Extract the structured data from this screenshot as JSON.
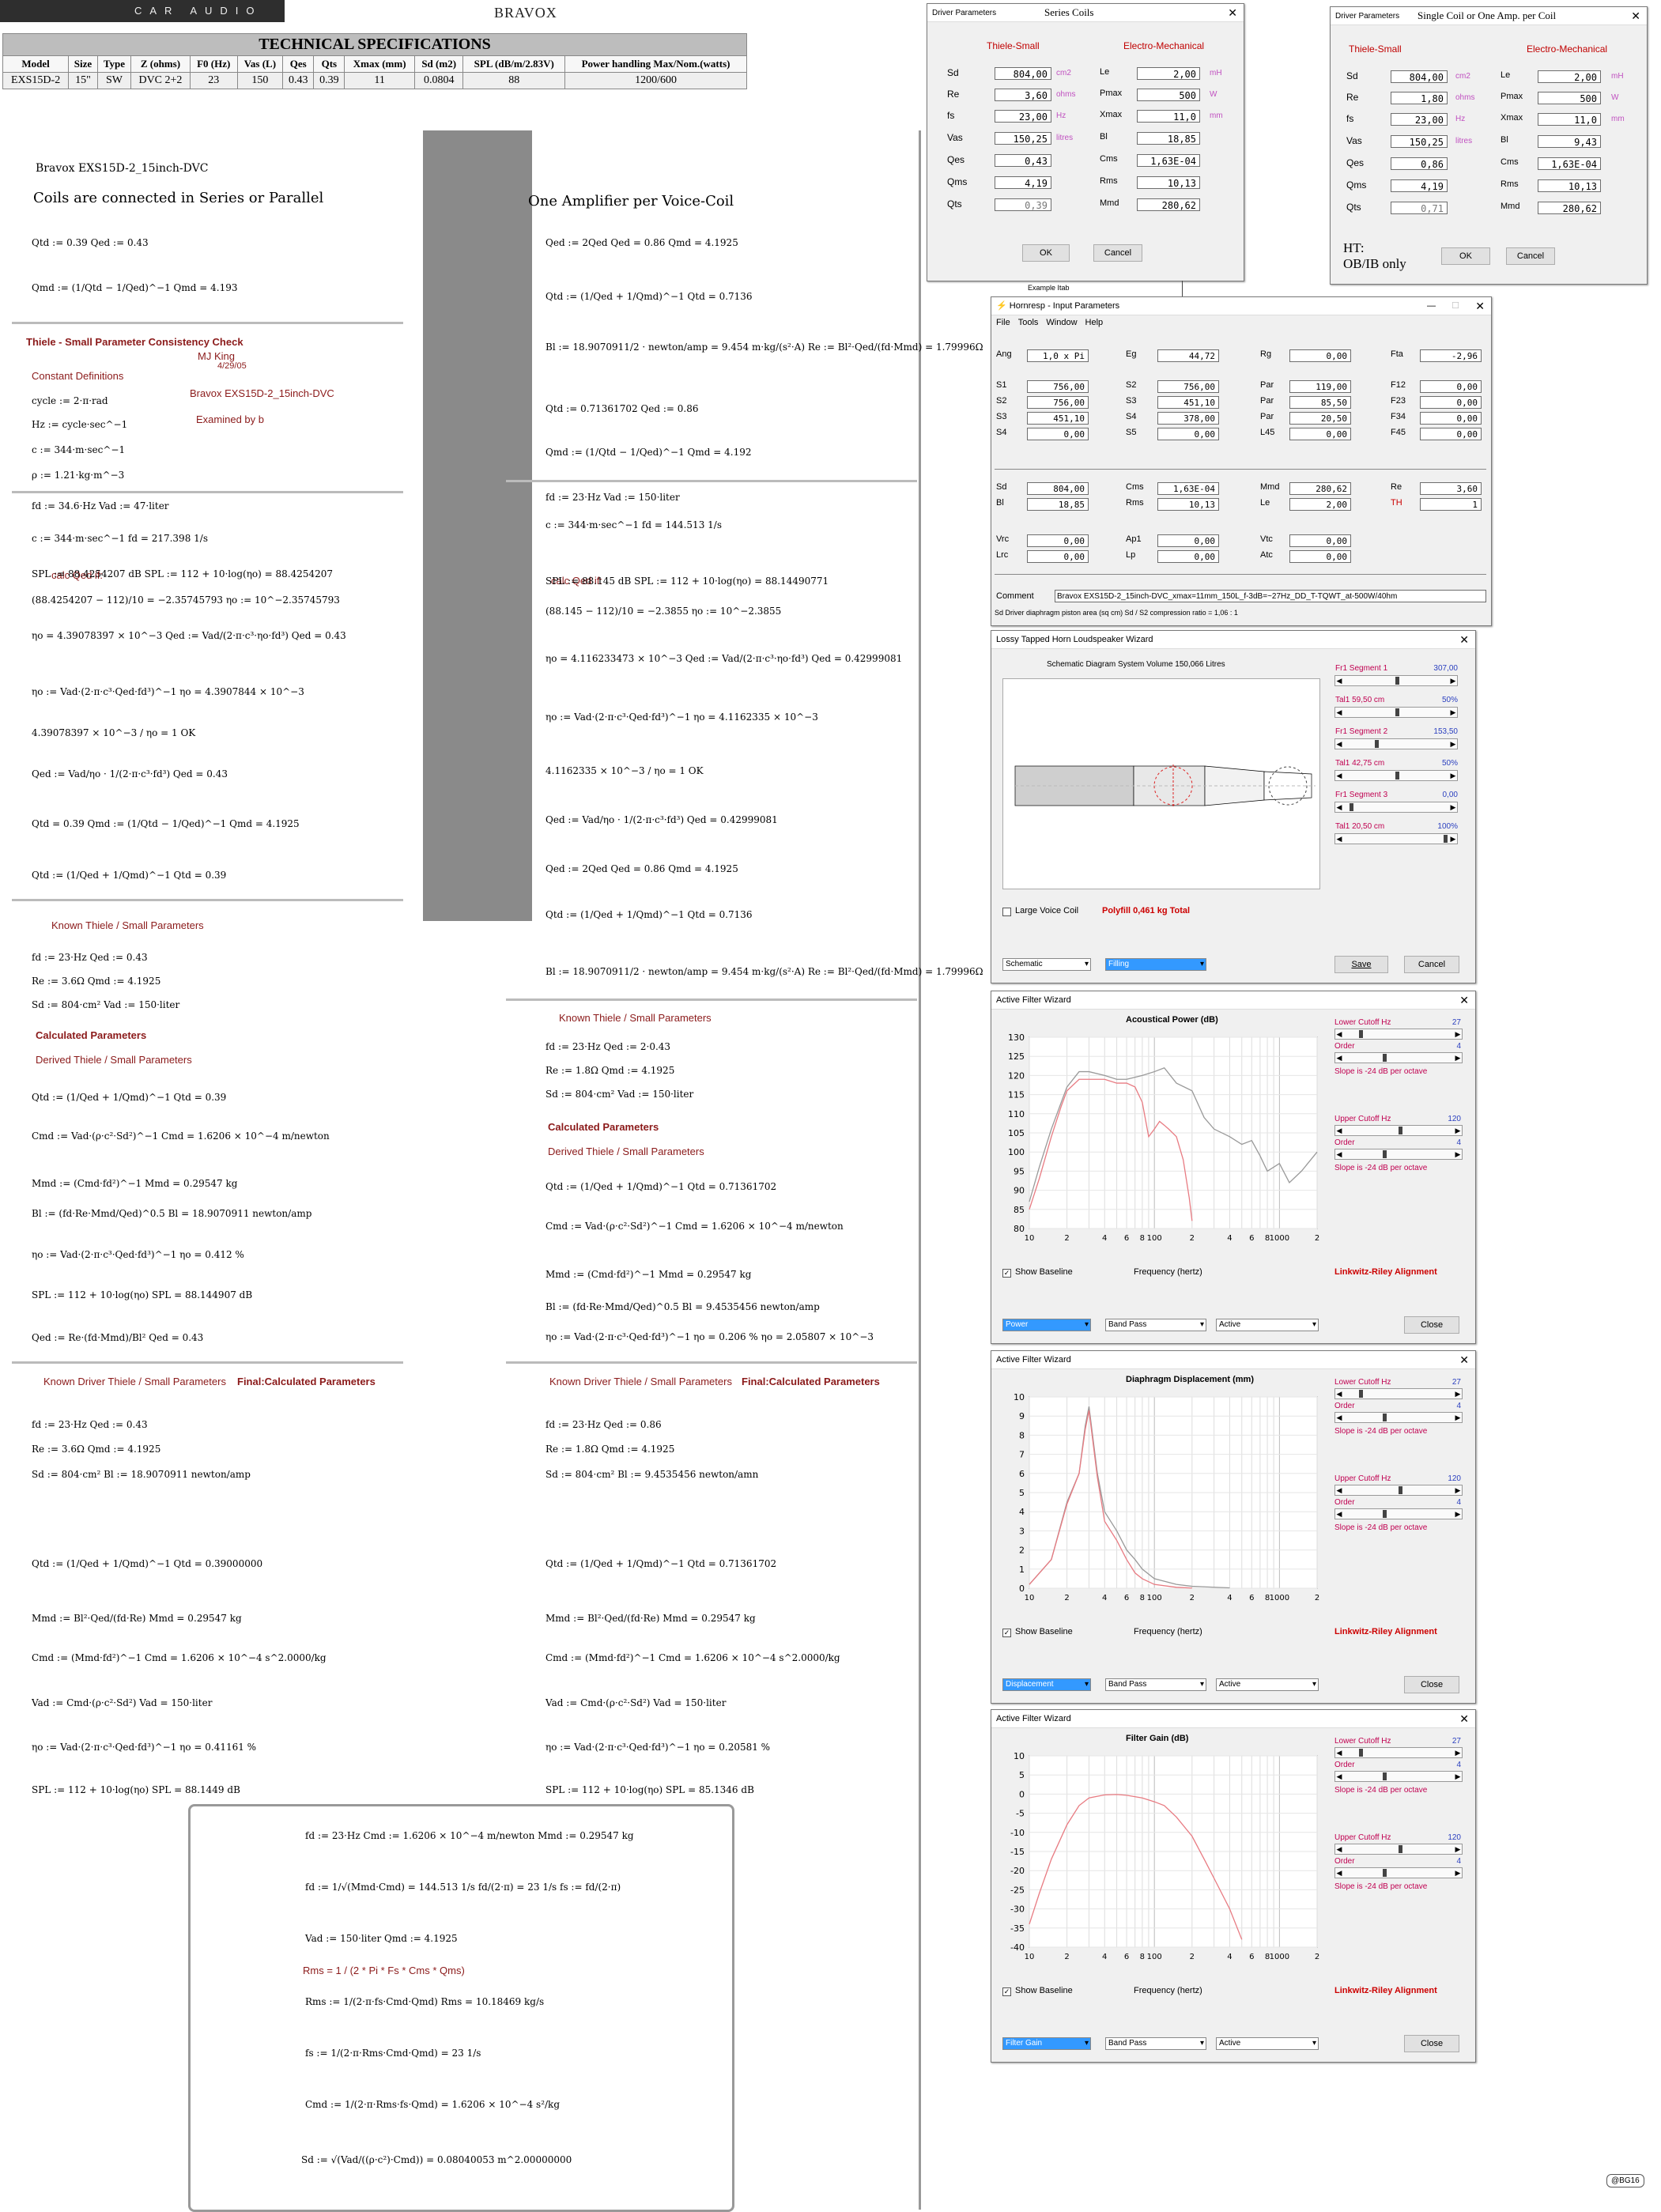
{
  "header": {
    "brand_left": "CAR AUDIO",
    "brand_right": "BRAVOX"
  },
  "spec_table": {
    "title": "TECHNICAL SPECIFICATIONS",
    "columns": [
      "Model",
      "Size",
      "Type",
      "Z (ohms)",
      "F0 (Hz)",
      "Vas (L)",
      "Qes",
      "Qts",
      "Xmax (mm)",
      "Sd (m2)",
      "SPL (dB/m/2.83V)",
      "Power handling Max/Nom.(watts)"
    ],
    "values": [
      "EXS15D-2",
      "15\"",
      "SW",
      "DVC 2+2",
      "23",
      "150",
      "0.43",
      "0.39",
      "11",
      "0.0804",
      "88",
      "1200/600"
    ]
  },
  "left": {
    "doc_title": "Bravox EXS15D-2_15inch-DVC",
    "heading": "Coils are connected in Series or Parallel",
    "consistency": "Thiele - Small Parameter Consistency Check",
    "author": "MJ King",
    "date": "4/29/05",
    "model_note": "Bravox EXS15D-2_15inch-DVC",
    "constants": "Constant Definitions",
    "examined": "Examined by b",
    "calc_qed": "calc Qed if:",
    "known": "Known Thiele / Small Parameters",
    "calculated": "Calculated Parameters",
    "derived": "Derived Thiele / Small Parameters",
    "final_known": "Known Driver Thiele / Small Parameters",
    "final_calc": "Final:Calculated Parameters",
    "eqs": [
      "Qtd := 0.39   Qed := 0.43",
      "Qmd := (1/Qtd − 1/Qed)^−1     Qmd = 4.193",
      "cycle := 2·π·rad",
      "Hz := cycle·sec^−1",
      "c := 344·m·sec^−1",
      "ρ := 1.21·kg·m^−3",
      "fd := 34.6·Hz        Vad := 47·liter",
      "c := 344·m·sec^−1        fd = 217.398 1/s",
      "SPL := 88.4254207 dB   SPL := 112 + 10·log(ηo) = 88.4254207",
      "(88.4254207 − 112)/10 = −2.35745793    ηo := 10^−2.35745793",
      "ηo = 4.39078397 × 10^−3    Qed := Vad/(2·π·c³·ηo·fd³)    Qed = 0.43",
      "ηo := Vad·(2·π·c³·Qed·fd³)^−1    ηo = 4.3907844 × 10^−3",
      "4.39078397 × 10^−3 / ηo = 1    OK",
      "Qed := Vad/ηo · 1/(2·π·c³·fd³)    Qed = 0.43",
      "Qtd = 0.39   Qmd := (1/Qtd − 1/Qed)^−1    Qmd = 4.1925",
      "Qtd := (1/Qed + 1/Qmd)^−1    Qtd = 0.39",
      "fd := 23·Hz        Qed := 0.43",
      "Re := 3.6Ω         Qmd := 4.1925",
      "Sd := 804·cm²      Vad := 150·liter",
      "Qtd := (1/Qed + 1/Qmd)^−1    Qtd = 0.39",
      "Cmd := Vad·(ρ·c²·Sd²)^−1    Cmd = 1.6206 × 10^−4 m/newton",
      "Mmd := (Cmd·fd²)^−1    Mmd = 0.29547 kg",
      "Bl := (fd·Re·Mmd/Qed)^0.5    Bl = 18.9070911 newton/amp",
      "ηo := Vad·(2·π·c³·Qed·fd³)^−1    ηo = 0.412 %",
      "SPL := 112 + 10·log(ηo)    SPL = 88.144907 dB",
      "Qed := Re·(fd·Mmd)/Bl²    Qed = 0.43",
      "fd := 23·Hz    Qed := 0.43",
      "Re := 3.6Ω    Qmd := 4.1925",
      "Sd := 804·cm²    Bl := 18.9070911 newton/amp",
      "Qtd := (1/Qed + 1/Qmd)^−1    Qtd = 0.39000000",
      "Mmd := Bl²·Qed/(fd·Re)    Mmd = 0.29547 kg",
      "Cmd := (Mmd·fd²)^−1    Cmd = 1.6206 × 10^−4 s^2.0000/kg",
      "Vad := Cmd·(ρ·c²·Sd²)    Vad = 150·liter",
      "ηo := Vad·(2·π·c³·Qed·fd³)^−1    ηo = 0.41161 %",
      "SPL := 112 + 10·log(ηo)    SPL = 88.1449 dB"
    ]
  },
  "mid": {
    "heading": "One Amplifier per Voice-Coil",
    "known": "Known Thiele / Small Parameters",
    "calculated": "Calculated Parameters",
    "derived": "Derived Thiele / Small Parameters",
    "final_known": "Known Driver Thiele / Small Parameters",
    "final_calc": "Final:Calculated Parameters",
    "calc_qed": "calc Qed if:",
    "eqs": [
      "Qed := 2Qed      Qed = 0.86      Qmd = 4.1925",
      "Qtd := (1/Qed + 1/Qmd)^−1     Qtd = 0.7136",
      "Bl := 18.9070911/2 · newton/amp = 9.454 m·kg/(s²·A)      Re := Bl²·Qed/(fd·Mmd) = 1.79996Ω",
      "Qtd := 0.71361702      Qed := 0.86",
      "Qmd := (1/Qtd − 1/Qed)^−1      Qmd = 4.192",
      "fd := 23·Hz      Vad := 150·liter",
      "c := 344·m·sec^−1      fd = 144.513 1/s",
      "SPL := 88.145      dB SPL := 112 + 10·log(ηo) = 88.14490771",
      "(88.145 − 112)/10 = −2.3855      ηo := 10^−2.3855",
      "ηo = 4.116233473 × 10^−3      Qed := Vad/(2·π·c³·ηo·fd³)      Qed = 0.42999081",
      "ηo := Vad·(2·π·c³·Qed·fd³)^−1      ηo = 4.1162335 × 10^−3",
      "4.1162335 × 10^−3 / ηo = 1      OK",
      "Qed := Vad/ηo · 1/(2·π·c³·fd³)      Qed = 0.42999081",
      "Qed := 2Qed      Qed = 0.86      Qmd = 4.1925",
      "Qtd := (1/Qed + 1/Qmd)^−1      Qtd = 0.7136",
      "Bl := 18.9070911/2 · newton/amp = 9.454 m·kg/(s²·A)      Re := Bl²·Qed/(fd·Mmd) = 1.79996Ω",
      "fd := 23·Hz      Qed := 2·0.43",
      "Re := 1.8Ω      Qmd := 4.1925",
      "Sd := 804·cm²      Vad := 150·liter",
      "Qtd := (1/Qed + 1/Qmd)^−1      Qtd = 0.71361702",
      "Cmd := Vad·(ρ·c²·Sd²)^−1      Cmd = 1.6206 × 10^−4 m/newton",
      "Mmd := (Cmd·fd²)^−1      Mmd = 0.29547 kg",
      "Bl := (fd·Re·Mmd/Qed)^0.5      Bl = 9.4535456 newton/amp",
      "ηo := Vad·(2·π·c³·Qed·fd³)^−1      ηo = 0.206 %      ηo = 2.05807 × 10^−3",
      "fd := 23·Hz      Qed := 0.86",
      "Re := 1.8Ω      Qmd := 4.1925",
      "Sd := 804·cm²      Bl := 9.4535456 newton/amn",
      "Qtd := (1/Qed + 1/Qmd)^−1      Qtd = 0.71361702",
      "Mmd := Bl²·Qed/(fd·Re)      Mmd = 0.29547 kg",
      "Cmd := (Mmd·fd²)^−1      Cmd = 1.6206 × 10^−4 s^2.0000/kg",
      "Vad := Cmd·(ρ·c²·Sd²)      Vad = 150·liter",
      "ηo := Vad·(2·π·c³·Qed·fd³)^−1      ηo = 0.20581 %",
      "SPL := 112 + 10·log(ηo)      SPL = 85.1346 dB"
    ]
  },
  "bottom_box": {
    "rms_formula": "Rms = 1 / (2 * Pi * Fs * Cms * Qms)",
    "eqs": [
      "fd := 23·Hz      Cmd := 1.6206 × 10^−4 m/newton      Mmd := 0.29547 kg",
      "fd := 1/√(Mmd·Cmd) = 144.513 1/s      fd/(2·π) = 23 1/s      fs := fd/(2·π)",
      "Vad := 150·liter      Qmd := 4.1925",
      "Rms := 1/(2·π·fs·Cmd·Qmd)      Rms = 10.18469 kg/s",
      "fs := 1/(2·π·Rms·Cmd·Qmd) = 23 1/s",
      "Cmd := 1/(2·π·Rms·fs·Qmd) = 1.6206 × 10^−4 s²/kg",
      "Sd := √(Vad/((ρ·c²)·Cmd)) = 0.08040053 m^2.00000000"
    ]
  },
  "win_series": {
    "title_small": "Driver Parameters",
    "title": "Series Coils",
    "ts_label": "Thiele-Small",
    "em_label": "Electro-Mechanical",
    "left_rows": [
      [
        "Sd",
        "804,00",
        "cm2"
      ],
      [
        "Re",
        "3,60",
        "ohms"
      ],
      [
        "fs",
        "23,00",
        "Hz"
      ],
      [
        "Vas",
        "150,25",
        "litres"
      ],
      [
        "Qes",
        "0,43",
        ""
      ],
      [
        "Qms",
        "4,19",
        ""
      ],
      [
        "Qts",
        "0,39",
        ""
      ]
    ],
    "right_rows": [
      [
        "Le",
        "2,00",
        "mH"
      ],
      [
        "Pmax",
        "500",
        "W"
      ],
      [
        "Xmax",
        "11,0",
        "mm"
      ],
      [
        "Bl",
        "18,85",
        ""
      ],
      [
        "Cms",
        "1,63E-04",
        ""
      ],
      [
        "Rms",
        "10,13",
        ""
      ],
      [
        "Mmd",
        "280,62",
        ""
      ]
    ],
    "ok": "OK",
    "cancel": "Cancel"
  },
  "win_single": {
    "title_small": "Driver Parameters",
    "title": "Single Coil or One Amp. per Coil",
    "ts_label": "Thiele-Small",
    "em_label": "Electro-Mechanical",
    "left_rows": [
      [
        "Sd",
        "804,00",
        "cm2"
      ],
      [
        "Re",
        "1,80",
        "ohms"
      ],
      [
        "fs",
        "23,00",
        "Hz"
      ],
      [
        "Vas",
        "150,25",
        "litres"
      ],
      [
        "Qes",
        "0,86",
        ""
      ],
      [
        "Qms",
        "4,19",
        ""
      ],
      [
        "Qts",
        "0,71",
        ""
      ]
    ],
    "right_rows": [
      [
        "Le",
        "2,00",
        "mH"
      ],
      [
        "Pmax",
        "500",
        "W"
      ],
      [
        "Xmax",
        "11,0",
        "mm"
      ],
      [
        "Bl",
        "9,43",
        ""
      ],
      [
        "Cms",
        "1,63E-04",
        ""
      ],
      [
        "Rms",
        "10,13",
        ""
      ],
      [
        "Mmd",
        "280,62",
        ""
      ]
    ],
    "note": "HT:\nOB/IB only",
    "ok": "OK",
    "cancel": "Cancel"
  },
  "example_tab": "Example Itab",
  "hornresp": {
    "title": "Hornresp - Input Parameters",
    "menu": [
      "File",
      "Tools",
      "Window",
      "Help"
    ],
    "rows": [
      [
        [
          "Ang",
          "1,0 x Pi"
        ],
        [
          "Eg",
          "44,72"
        ],
        [
          "Rg",
          "0,00"
        ],
        [
          "Fta",
          "-2,96"
        ]
      ],
      [
        [
          "S1",
          "756,00"
        ],
        [
          "S2",
          "756,00"
        ],
        [
          "Par",
          "119,00"
        ],
        [
          "F12",
          "0,00"
        ]
      ],
      [
        [
          "S2",
          "756,00"
        ],
        [
          "S3",
          "451,10"
        ],
        [
          "Par",
          "85,50"
        ],
        [
          "F23",
          "0,00"
        ]
      ],
      [
        [
          "S3",
          "451,10"
        ],
        [
          "S4",
          "378,00"
        ],
        [
          "Par",
          "20,50"
        ],
        [
          "F34",
          "0,00"
        ]
      ],
      [
        [
          "S4",
          "0,00"
        ],
        [
          "S5",
          "0,00"
        ],
        [
          "L45",
          "0,00"
        ],
        [
          "F45",
          "0,00"
        ]
      ],
      [
        [
          "Sd",
          "804,00"
        ],
        [
          "Cms",
          "1,63E-04"
        ],
        [
          "Mmd",
          "280,62"
        ],
        [
          "Re",
          "3,60"
        ]
      ],
      [
        [
          "Bl",
          "18,85"
        ],
        [
          "Rms",
          "10,13"
        ],
        [
          "Le",
          "2,00"
        ],
        [
          "TH",
          "1"
        ]
      ],
      [
        [
          "Vrc",
          "0,00"
        ],
        [
          "Ap1",
          "0,00"
        ],
        [
          "Vtc",
          "0,00"
        ],
        [
          "",
          ""
        ]
      ],
      [
        [
          "Lrc",
          "0,00"
        ],
        [
          "Lp",
          "0,00"
        ],
        [
          "Atc",
          "0,00"
        ],
        [
          "",
          ""
        ]
      ]
    ],
    "comment_label": "Comment",
    "comment": "Bravox EXS15D-2_15inch-DVC_xmax=11mm_150L_f-3dB=~27Hz_DD_T-TQWT_at-500W/40hm",
    "status": "Sd  Driver diaphragm piston area  (sq cm)  Sd / S2 compression ratio = 1,06 : 1"
  },
  "lossy": {
    "title": "Lossy Tapped Horn Loudspeaker Wizard",
    "diagram_title": "Schematic Diagram   System Volume 150,066 Litres",
    "sliders": [
      [
        "Fr1  Segment 1",
        "307,00"
      ],
      [
        "Tal1  59,50 cm",
        "50%"
      ],
      [
        "Fr1  Segment 2",
        "153,50"
      ],
      [
        "Tal1  42,75 cm",
        "50%"
      ],
      [
        "Fr1  Segment 3",
        "0,00"
      ],
      [
        "Tal1  20,50 cm",
        "100%"
      ]
    ],
    "large_vc": "Large Voice Coil",
    "polyfill": "Polyfill   0,461  kg   Total",
    "dd1": "Schematic",
    "dd2": "Filling",
    "save": "Save",
    "cancel": "Cancel"
  },
  "filter_common": {
    "title": "Active Filter Wizard",
    "lower": "Lower Cutoff  Hz",
    "lower_val": "27",
    "order": "Order",
    "order_val": "4",
    "slope": "Slope is -24 dB per octave",
    "upper": "Upper Cutoff  Hz",
    "upper_val": "120",
    "show_baseline": "Show Baseline",
    "freq_label": "Frequency (hertz)",
    "alignment": "Linkwitz-Riley Alignment",
    "band_pass": "Band Pass",
    "active": "Active",
    "close": "Close",
    "x_ticks": [
      "10",
      "2",
      "4",
      "6",
      "8",
      "100",
      "2",
      "4",
      "6",
      "8",
      "1000",
      "2"
    ]
  },
  "chart_data": [
    {
      "type": "line",
      "title": "Acoustical Power (dB)",
      "xlabel": "Frequency (hertz)",
      "ylabel": "",
      "log_x": true,
      "ylim": [
        80,
        130
      ],
      "yticks": [
        130,
        125,
        120,
        115,
        110,
        105,
        100,
        95,
        90,
        85,
        80
      ],
      "series": [
        {
          "color": "#999999",
          "x": [
            10,
            12,
            15,
            18,
            20,
            25,
            30,
            40,
            50,
            60,
            80,
            100,
            120,
            150,
            200,
            250,
            300,
            400,
            500,
            600,
            700,
            800,
            1000,
            1200,
            1500,
            2000
          ],
          "values": [
            87,
            96,
            106,
            113,
            117,
            121,
            121,
            120,
            119,
            119,
            120,
            121,
            122,
            118,
            116,
            109,
            106,
            104,
            102,
            103,
            99,
            95,
            97,
            92,
            95,
            100
          ]
        },
        {
          "color": "#e87b82",
          "x": [
            10,
            12,
            15,
            18,
            20,
            25,
            30,
            40,
            50,
            60,
            70,
            80,
            90,
            100,
            110,
            120,
            130,
            150,
            170,
            190,
            200
          ],
          "values": [
            85,
            93,
            104,
            112,
            116,
            119,
            119,
            119,
            118,
            118,
            117,
            113,
            104,
            106,
            108,
            107,
            106,
            104,
            98,
            88,
            82
          ]
        }
      ],
      "dropdown": "Power"
    },
    {
      "type": "line",
      "title": "Diaphragm Displacement (mm)",
      "xlabel": "Frequency (hertz)",
      "ylabel": "",
      "log_x": true,
      "ylim": [
        0,
        10
      ],
      "yticks": [
        10,
        9,
        8,
        7,
        6,
        5,
        4,
        3,
        2,
        1,
        0
      ],
      "series": [
        {
          "color": "#999999",
          "x": [
            10,
            15,
            20,
            25,
            28,
            30,
            35,
            40,
            50,
            60,
            70,
            80,
            100,
            150,
            200,
            400
          ],
          "values": [
            0.2,
            1.5,
            4.5,
            6,
            8.5,
            9.5,
            6,
            4,
            3,
            2,
            1.5,
            1,
            0.5,
            0.2,
            0.1,
            0.02
          ]
        },
        {
          "color": "#e87b82",
          "x": [
            10,
            15,
            20,
            25,
            28,
            30,
            35,
            40,
            50,
            60,
            70,
            80,
            100,
            150,
            200
          ],
          "values": [
            0.2,
            1.5,
            4.4,
            6,
            8.3,
            9.3,
            5.8,
            3.5,
            2.5,
            1.5,
            0.8,
            0.5,
            0.2,
            0.05,
            0.01
          ]
        }
      ],
      "dropdown": "Displacement"
    },
    {
      "type": "line",
      "title": "Filter Gain (dB)",
      "xlabel": "Frequency (hertz)",
      "ylabel": "",
      "log_x": true,
      "ylim": [
        -40,
        10
      ],
      "yticks": [
        10,
        5,
        0,
        -5,
        -10,
        -15,
        -20,
        -25,
        -30,
        -35,
        -40
      ],
      "series": [
        {
          "color": "#e87b82",
          "x": [
            10,
            12,
            15,
            20,
            25,
            30,
            40,
            50,
            60,
            80,
            100,
            120,
            150,
            200,
            250,
            300,
            400,
            500
          ],
          "values": [
            -34,
            -26,
            -17,
            -8,
            -3,
            -1,
            -0.2,
            -0.1,
            -0.3,
            -1,
            -2,
            -3,
            -6,
            -11,
            -17,
            -22,
            -30,
            -38
          ]
        }
      ],
      "dropdown": "Filter Gain"
    }
  ],
  "signature": "@BG16"
}
